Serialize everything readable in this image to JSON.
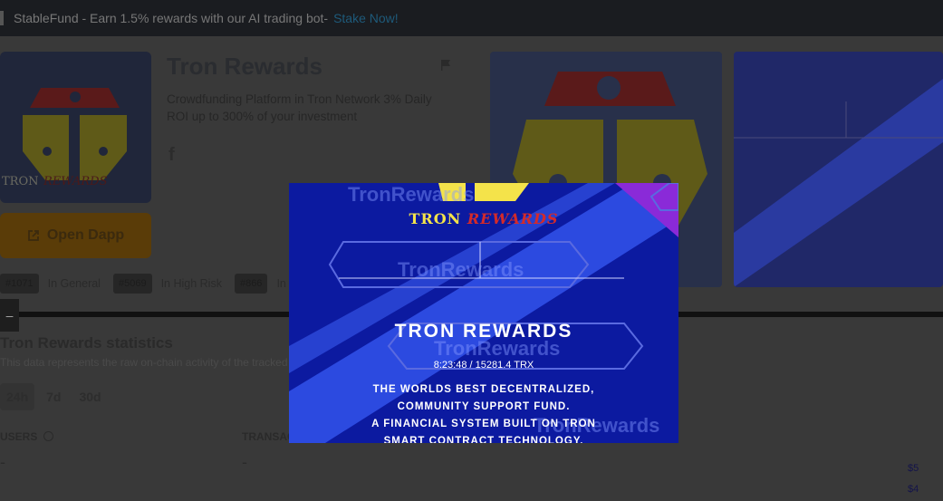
{
  "banner": {
    "text": "StableFund - Earn 1.5% rewards with our AI trading bot-",
    "link": "Stake Now!"
  },
  "app": {
    "title": "Tron Rewards",
    "description": "Crowdfunding Platform in Tron Network 3% Daily ROI up to 300% of your investment",
    "open_button": "Open Dapp",
    "logo_text_a": "TRON",
    "logo_text_b": "REWARDS"
  },
  "ranks": [
    {
      "badge": "#1071",
      "label": "In General"
    },
    {
      "badge": "#5069",
      "label": "In High Risk"
    },
    {
      "badge": "#866",
      "label": "In"
    }
  ],
  "stats": {
    "title": "Tron Rewards statistics",
    "subtitle": "This data represents the raw on-chain activity of the tracked",
    "tabs": [
      "24h",
      "7d",
      "30d"
    ],
    "users_label": "USERS",
    "users_value": "-",
    "tx_label": "TRANSAC",
    "tx_value": "-",
    "axis": [
      "$5",
      "$4"
    ]
  },
  "overlay": {
    "brand_a": "TRON",
    "brand_b": "REWARDS",
    "watermark": "TronRewards",
    "title": "TRON REWARDS",
    "stat": "8:23:48 / 15281.4 TRX",
    "lines": [
      "THE WORLDS BEST DECENTRALIZED,",
      "COMMUNITY SUPPORT FUND.",
      "A FINANCIAL SYSTEM BUILT ON TRON",
      "SMART CONTRACT TECHNOLOGY."
    ]
  },
  "colors": {
    "accent": "#2a8fc4",
    "overlay_bg": "#0c1aa0",
    "logo_yellow": "#f4e34a",
    "logo_red": "#d42a2a"
  }
}
